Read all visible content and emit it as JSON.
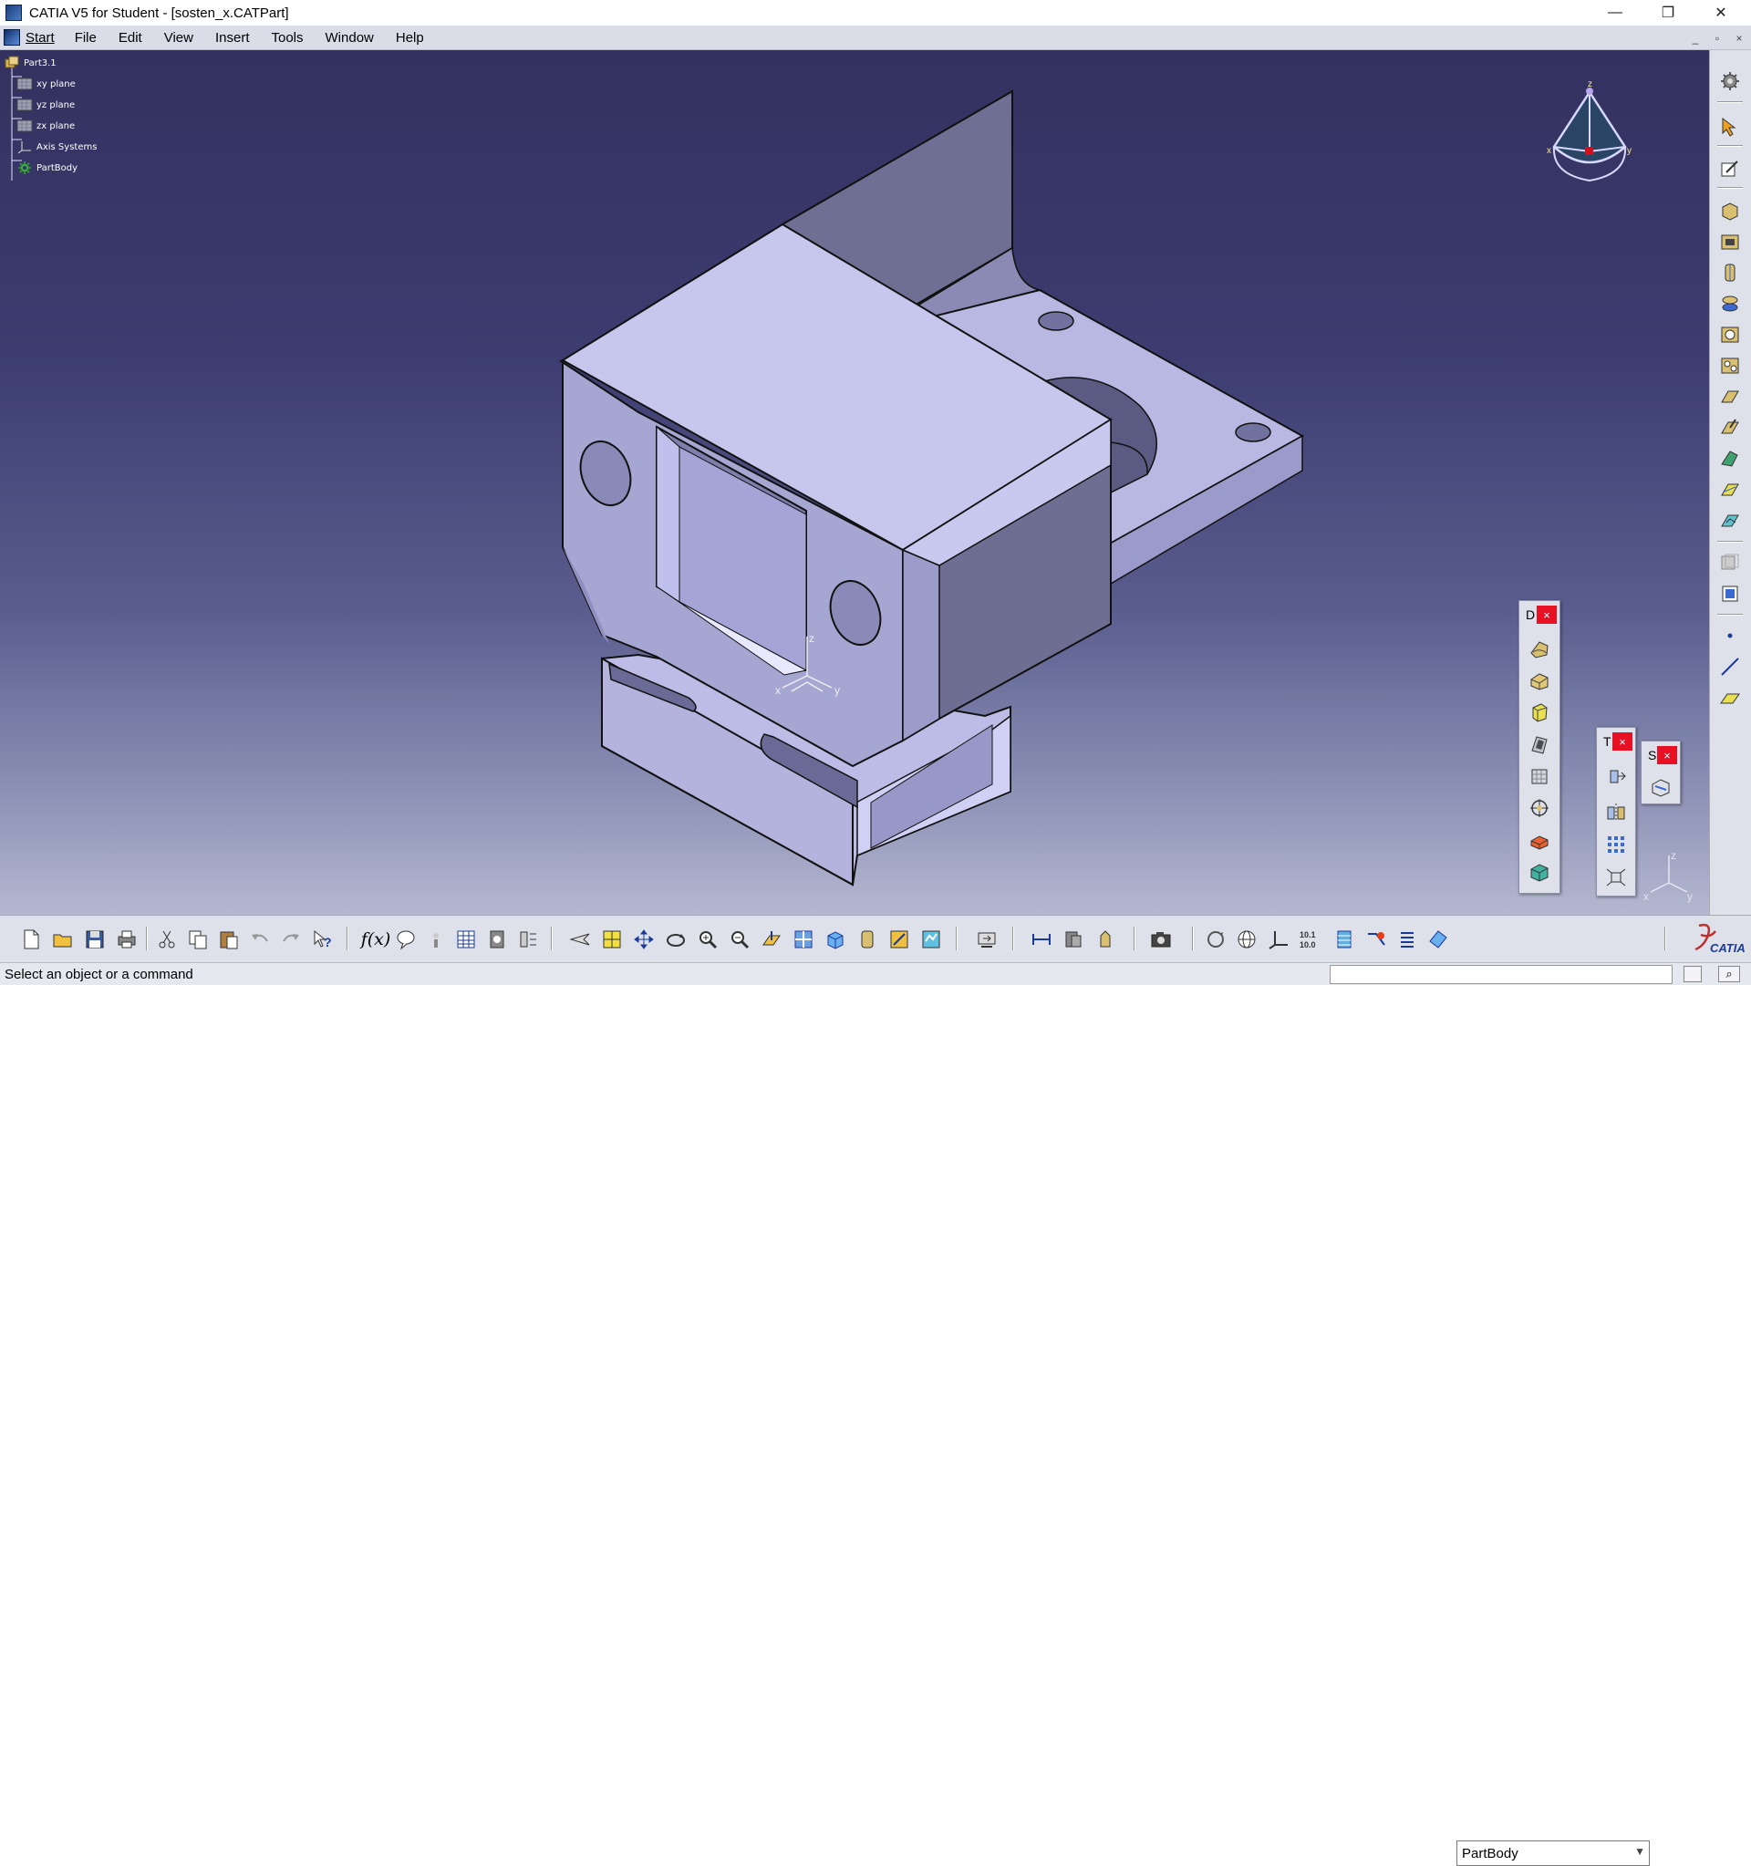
{
  "window": {
    "title": "CATIA V5 for Student - [sosten_x.CATPart]",
    "minimize": "—",
    "restore": "❐",
    "close": "✕"
  },
  "menu": {
    "start": "Start",
    "items": [
      "File",
      "Edit",
      "View",
      "Insert",
      "Tools",
      "Window",
      "Help"
    ],
    "mdi": [
      "_",
      "▫",
      "×"
    ]
  },
  "tree": {
    "root": "Part3.1",
    "children": [
      "xy plane",
      "yz plane",
      "zx plane",
      "Axis Systems",
      "PartBody"
    ]
  },
  "axes": {
    "x": "x",
    "y": "y",
    "z": "z"
  },
  "panels": {
    "dress_up": {
      "title": "D",
      "close": "×"
    },
    "transform": {
      "title": "T",
      "close": "×"
    },
    "surface": {
      "title": "S",
      "close": "×"
    }
  },
  "toolbar": {
    "current_body": "PartBody",
    "formula_label": "f(x)"
  },
  "status": {
    "message": "Select an object or a command"
  },
  "brand": "CATIA",
  "colors": {
    "part_light": "#c5c5ec",
    "part_mid": "#a4a4d0",
    "part_dark": "#6e6e93",
    "background_top": "#33315f",
    "background_bottom": "#b4b8d0"
  }
}
